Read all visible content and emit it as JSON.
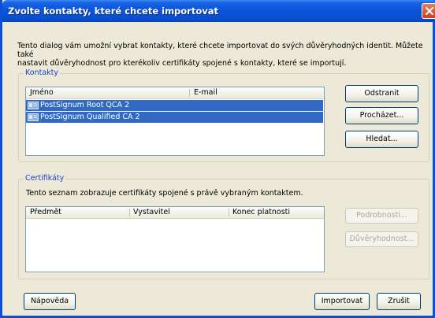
{
  "window": {
    "title": "Zvolte kontakty, které chcete importovat"
  },
  "description_lines": [
    "Tento dialog vám umožní vybrat kontakty, které chcete importovat do svých důvěryhodných identit. Můžete také",
    "nastavit důvěryhodnost pro kterékoliv certifikáty spojené s kontakty, které se importují."
  ],
  "contacts": {
    "label": "Kontakty",
    "columns": [
      "Jméno",
      "E-mail"
    ],
    "rows": [
      {
        "name": "PostSignum Root QCA 2",
        "email": "",
        "selected": true
      },
      {
        "name": "PostSignum Qualified CA 2",
        "email": "",
        "selected": true
      }
    ],
    "buttons": {
      "remove": "Odstranit",
      "browse": "Procházet...",
      "search": "Hledat..."
    }
  },
  "certificates": {
    "label": "Certifikáty",
    "info": "Tento seznam zobrazuje certifikáty spojené s právě vybraným kontaktem.",
    "columns": [
      "Předmět",
      "Vystavitel",
      "Konec platnosti"
    ],
    "buttons": {
      "details": "Podrobnosti...",
      "trust": "Důvěryhodnost..."
    }
  },
  "footer": {
    "help": "Nápověda",
    "import": "Importovat",
    "cancel": "Zrušit"
  },
  "colors": {
    "titlebar": "#0a54d8",
    "selection": "#316ac5",
    "group_label": "#1b43c7"
  },
  "icons": {
    "close": "close-icon",
    "contact": "contact-card-icon"
  }
}
